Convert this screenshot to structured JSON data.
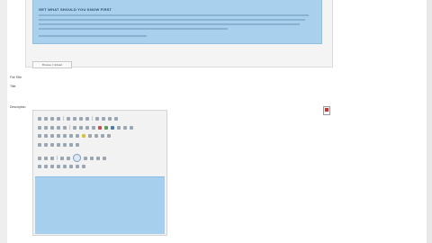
{
  "notice": {
    "title": "GET WHAT SHOULD YOU KNOW FIRST"
  },
  "upload_button_label": "Browse  |  Upload",
  "fields": {
    "file_title_label": "File Title",
    "title_label": "Title",
    "description_label": "Description"
  },
  "colors": {
    "notice_bg": "#a9d1ee",
    "editor_area_bg": "#a6cfee",
    "frame_bg": "#f4f4f4"
  },
  "icons": {
    "side": "pdf-file-icon"
  }
}
